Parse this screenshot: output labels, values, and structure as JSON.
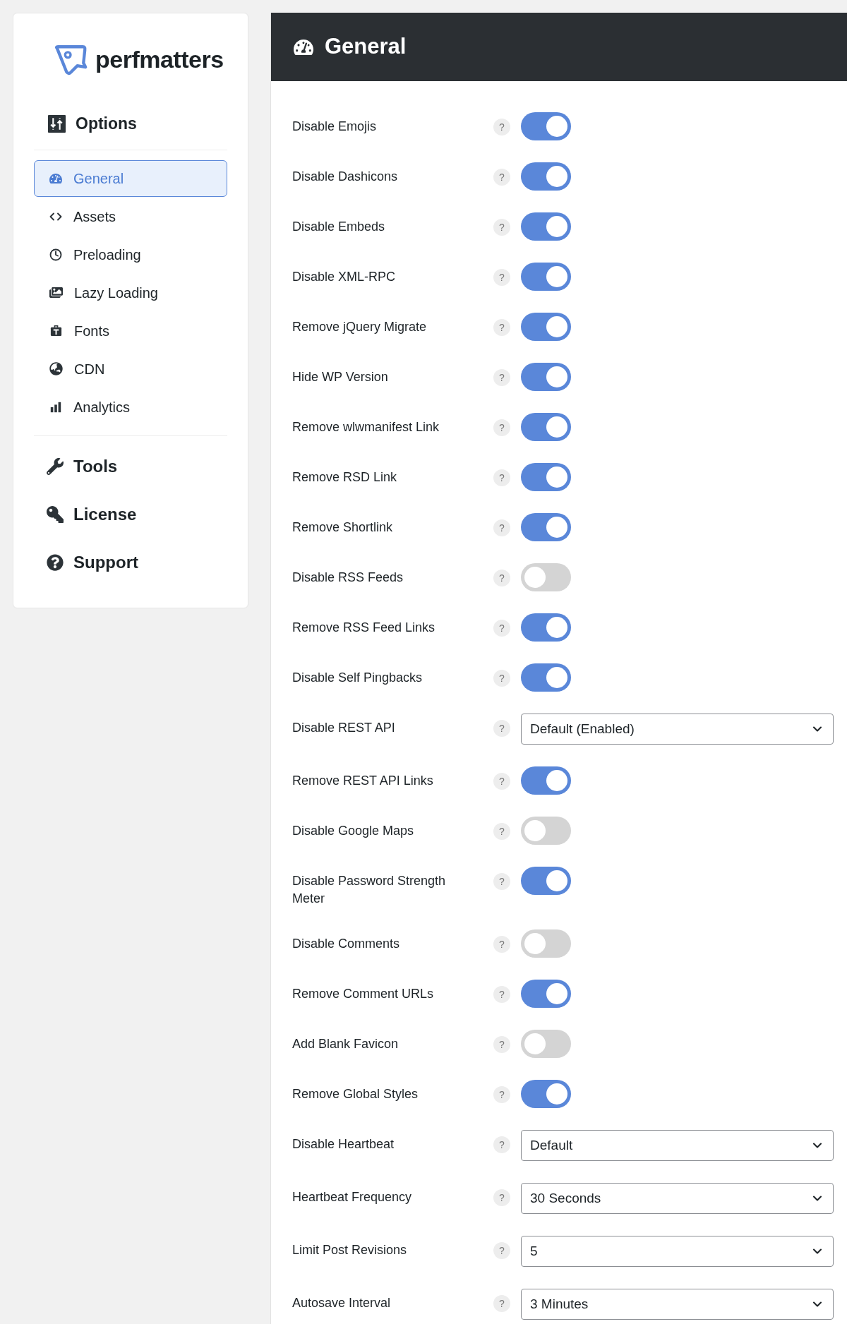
{
  "sidebar": {
    "logo": "perfmatters",
    "options_heading": "Options",
    "items": [
      {
        "label": "General",
        "selected": true
      },
      {
        "label": "Assets",
        "selected": false
      },
      {
        "label": "Preloading",
        "selected": false
      },
      {
        "label": "Lazy Loading",
        "selected": false
      },
      {
        "label": "Fonts",
        "selected": false
      },
      {
        "label": "CDN",
        "selected": false
      },
      {
        "label": "Analytics",
        "selected": false
      }
    ],
    "sections": [
      {
        "label": "Tools"
      },
      {
        "label": "License"
      },
      {
        "label": "Support"
      }
    ]
  },
  "panel": {
    "title": "General",
    "settings": [
      {
        "kind": "toggle",
        "label": "Disable Emojis",
        "help": "?",
        "on": true
      },
      {
        "kind": "toggle",
        "label": "Disable Dashicons",
        "help": "?",
        "on": true
      },
      {
        "kind": "toggle",
        "label": "Disable Embeds",
        "help": "?",
        "on": true
      },
      {
        "kind": "toggle",
        "label": "Disable XML-RPC",
        "help": "?",
        "on": true
      },
      {
        "kind": "toggle",
        "label": "Remove jQuery Migrate",
        "help": "?",
        "on": true
      },
      {
        "kind": "toggle",
        "label": "Hide WP Version",
        "help": "?",
        "on": true
      },
      {
        "kind": "toggle",
        "label": "Remove wlwmanifest Link",
        "help": "?",
        "on": true
      },
      {
        "kind": "toggle",
        "label": "Remove RSD Link",
        "help": "?",
        "on": true
      },
      {
        "kind": "toggle",
        "label": "Remove Shortlink",
        "help": "?",
        "on": true
      },
      {
        "kind": "toggle",
        "label": "Disable RSS Feeds",
        "help": "?",
        "on": false
      },
      {
        "kind": "toggle",
        "label": "Remove RSS Feed Links",
        "help": "?",
        "on": true
      },
      {
        "kind": "toggle",
        "label": "Disable Self Pingbacks",
        "help": "?",
        "on": true
      },
      {
        "kind": "select",
        "label": "Disable REST API",
        "help": "?",
        "value": "Default (Enabled)"
      },
      {
        "kind": "toggle",
        "label": "Remove REST API Links",
        "help": "?",
        "on": true
      },
      {
        "kind": "toggle",
        "label": "Disable Google Maps",
        "help": "?",
        "on": false
      },
      {
        "kind": "toggle",
        "label": "Disable Password Strength Meter",
        "help": "?",
        "on": true
      },
      {
        "kind": "toggle",
        "label": "Disable Comments",
        "help": "?",
        "on": false
      },
      {
        "kind": "toggle",
        "label": "Remove Comment URLs",
        "help": "?",
        "on": true
      },
      {
        "kind": "toggle",
        "label": "Add Blank Favicon",
        "help": "?",
        "on": false
      },
      {
        "kind": "toggle",
        "label": "Remove Global Styles",
        "help": "?",
        "on": true
      },
      {
        "kind": "select",
        "label": "Disable Heartbeat",
        "help": "?",
        "value": "Default"
      },
      {
        "kind": "select",
        "label": "Heartbeat Frequency",
        "help": "?",
        "value": "30 Seconds"
      },
      {
        "kind": "select",
        "label": "Limit Post Revisions",
        "help": "?",
        "value": "5"
      },
      {
        "kind": "select",
        "label": "Autosave Interval",
        "help": "?",
        "value": "3 Minutes"
      }
    ]
  }
}
